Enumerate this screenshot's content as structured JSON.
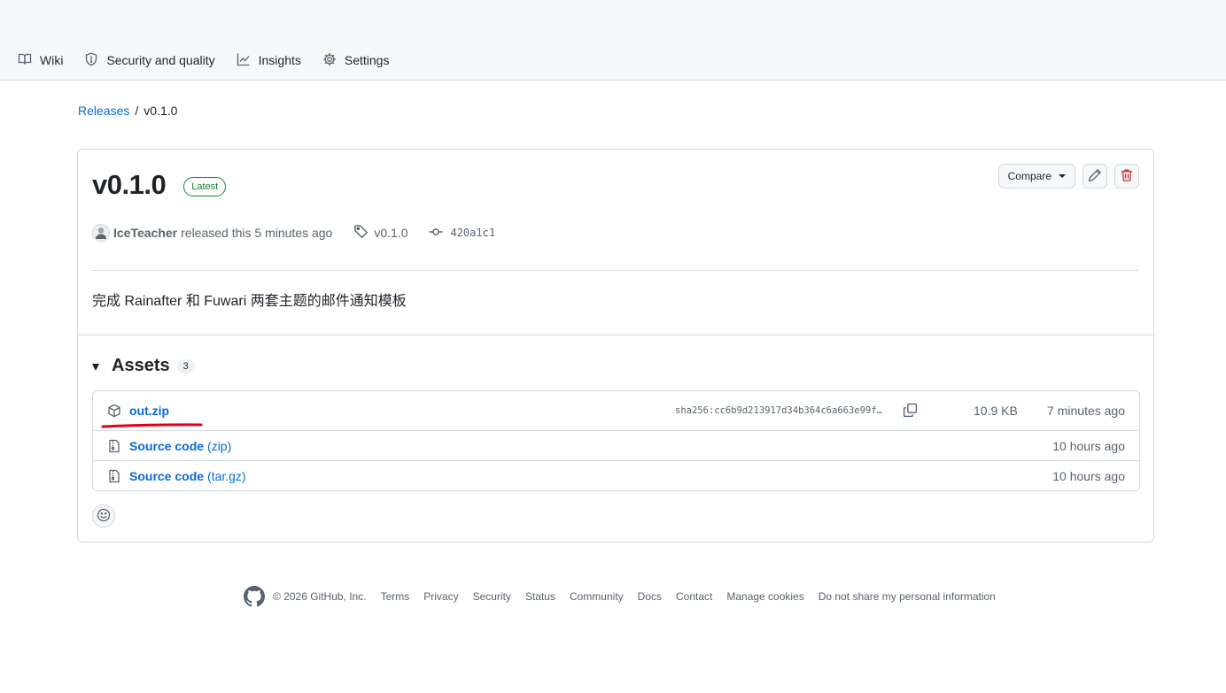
{
  "nav": {
    "tabs": [
      {
        "label": "Wiki",
        "icon": "book-icon"
      },
      {
        "label": "Security and quality",
        "icon": "shield-icon"
      },
      {
        "label": "Insights",
        "icon": "graph-icon"
      },
      {
        "label": "Settings",
        "icon": "gear-icon"
      }
    ]
  },
  "breadcrumb": {
    "parent": "Releases",
    "separator": "/",
    "current": "v0.1.0"
  },
  "release": {
    "title": "v0.1.0",
    "badge": "Latest",
    "compare_label": "Compare",
    "author": "IceTeacher",
    "released_text": "released this 5 minutes ago",
    "tag": "v0.1.0",
    "commit": "420a1c1",
    "body": "完成 Rainafter 和 Fuwari 两套主题的邮件通知模板"
  },
  "assets": {
    "title": "Assets",
    "count": "3",
    "items": [
      {
        "name": "out.zip",
        "suffix": "",
        "sha": "sha256:cc6b9d213917d34b364c6a663e99f…",
        "size": "10.9 KB",
        "time": "7 minutes ago",
        "icon": "package-icon"
      },
      {
        "name": "Source code",
        "suffix": "(zip)",
        "time": "10 hours ago",
        "icon": "file-zip-icon"
      },
      {
        "name": "Source code",
        "suffix": "(tar.gz)",
        "time": "10 hours ago",
        "icon": "file-zip-icon"
      }
    ]
  },
  "footer": {
    "copyright": "© 2026 GitHub, Inc.",
    "links": [
      "Terms",
      "Privacy",
      "Security",
      "Status",
      "Community",
      "Docs",
      "Contact",
      "Manage cookies",
      "Do not share my personal information"
    ]
  },
  "colors": {
    "link": "#0969da",
    "muted": "#59636e",
    "latest_green": "#1a7f37",
    "danger": "#d1242f",
    "annotation_red": "#e5001a"
  }
}
